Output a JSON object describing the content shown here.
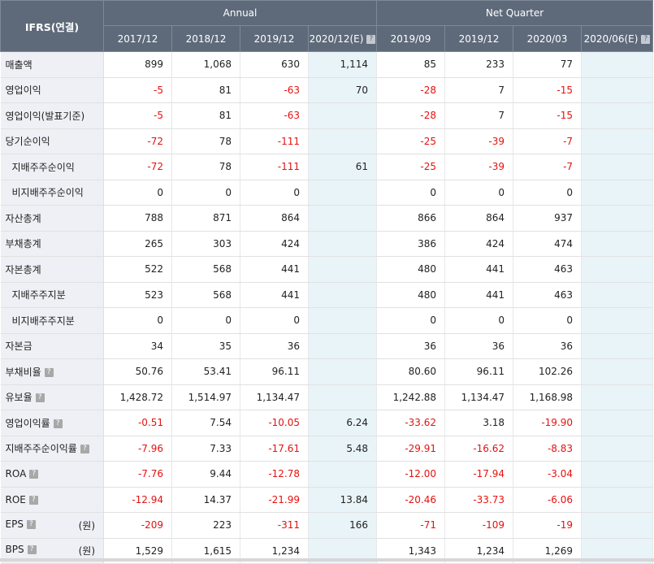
{
  "header": {
    "corner": "IFRS(연결)",
    "annual_label": "Annual",
    "quarter_label": "Net Quarter",
    "annual_periods": [
      "2017/12",
      "2018/12",
      "2019/12",
      "2020/12(E)"
    ],
    "quarter_periods": [
      "2019/09",
      "2019/12",
      "2020/03",
      "2020/06(E)"
    ]
  },
  "rows": [
    {
      "label": "매출액",
      "help": false,
      "sub": false,
      "unit": "",
      "values": [
        "899",
        "1,068",
        "630",
        "1,114",
        "85",
        "233",
        "77",
        ""
      ]
    },
    {
      "label": "영업이익",
      "help": false,
      "sub": false,
      "unit": "",
      "values": [
        "-5",
        "81",
        "-63",
        "70",
        "-28",
        "7",
        "-15",
        ""
      ]
    },
    {
      "label": "영업이익(발표기준)",
      "help": false,
      "sub": false,
      "unit": "",
      "values": [
        "-5",
        "81",
        "-63",
        "",
        "-28",
        "7",
        "-15",
        ""
      ]
    },
    {
      "label": "당기순이익",
      "help": false,
      "sub": false,
      "unit": "",
      "values": [
        "-72",
        "78",
        "-111",
        "",
        "-25",
        "-39",
        "-7",
        ""
      ]
    },
    {
      "label": "지배주주순이익",
      "help": false,
      "sub": true,
      "unit": "",
      "values": [
        "-72",
        "78",
        "-111",
        "61",
        "-25",
        "-39",
        "-7",
        ""
      ]
    },
    {
      "label": "비지배주주순이익",
      "help": false,
      "sub": true,
      "unit": "",
      "values": [
        "0",
        "0",
        "0",
        "",
        "0",
        "0",
        "0",
        ""
      ]
    },
    {
      "label": "자산총계",
      "help": false,
      "sub": false,
      "unit": "",
      "values": [
        "788",
        "871",
        "864",
        "",
        "866",
        "864",
        "937",
        ""
      ]
    },
    {
      "label": "부채총계",
      "help": false,
      "sub": false,
      "unit": "",
      "values": [
        "265",
        "303",
        "424",
        "",
        "386",
        "424",
        "474",
        ""
      ]
    },
    {
      "label": "자본총계",
      "help": false,
      "sub": false,
      "unit": "",
      "values": [
        "522",
        "568",
        "441",
        "",
        "480",
        "441",
        "463",
        ""
      ]
    },
    {
      "label": "지배주주지분",
      "help": false,
      "sub": true,
      "unit": "",
      "values": [
        "523",
        "568",
        "441",
        "",
        "480",
        "441",
        "463",
        ""
      ]
    },
    {
      "label": "비지배주주지분",
      "help": false,
      "sub": true,
      "unit": "",
      "values": [
        "0",
        "0",
        "0",
        "",
        "0",
        "0",
        "0",
        ""
      ]
    },
    {
      "label": "자본금",
      "help": false,
      "sub": false,
      "unit": "",
      "values": [
        "34",
        "35",
        "36",
        "",
        "36",
        "36",
        "36",
        ""
      ]
    },
    {
      "label": "부채비율",
      "help": true,
      "sub": false,
      "unit": "",
      "values": [
        "50.76",
        "53.41",
        "96.11",
        "",
        "80.60",
        "96.11",
        "102.26",
        ""
      ]
    },
    {
      "label": "유보율",
      "help": true,
      "sub": false,
      "unit": "",
      "values": [
        "1,428.72",
        "1,514.97",
        "1,134.47",
        "",
        "1,242.88",
        "1,134.47",
        "1,168.98",
        ""
      ]
    },
    {
      "label": "영업이익률",
      "help": true,
      "sub": false,
      "unit": "",
      "values": [
        "-0.51",
        "7.54",
        "-10.05",
        "6.24",
        "-33.62",
        "3.18",
        "-19.90",
        ""
      ]
    },
    {
      "label": "지배주주순이익률",
      "help": true,
      "sub": false,
      "unit": "",
      "values": [
        "-7.96",
        "7.33",
        "-17.61",
        "5.48",
        "-29.91",
        "-16.62",
        "-8.83",
        ""
      ]
    },
    {
      "label": "ROA",
      "help": true,
      "sub": false,
      "unit": "",
      "values": [
        "-7.76",
        "9.44",
        "-12.78",
        "",
        "-12.00",
        "-17.94",
        "-3.04",
        ""
      ]
    },
    {
      "label": "ROE",
      "help": true,
      "sub": false,
      "unit": "",
      "values": [
        "-12.94",
        "14.37",
        "-21.99",
        "13.84",
        "-20.46",
        "-33.73",
        "-6.06",
        ""
      ]
    },
    {
      "label": "EPS",
      "help": true,
      "sub": false,
      "unit": "(원)",
      "values": [
        "-209",
        "223",
        "-311",
        "166",
        "-71",
        "-109",
        "-19",
        ""
      ]
    },
    {
      "label": "BPS",
      "help": true,
      "sub": false,
      "unit": "(원)",
      "values": [
        "1,529",
        "1,615",
        "1,234",
        "",
        "1,343",
        "1,234",
        "1,269",
        ""
      ]
    }
  ],
  "colors": {
    "header_bg": "#5e6a7a",
    "label_bg": "#eef0f5",
    "estimate_bg": "#e9f4f8",
    "negative": "#e4120f"
  }
}
